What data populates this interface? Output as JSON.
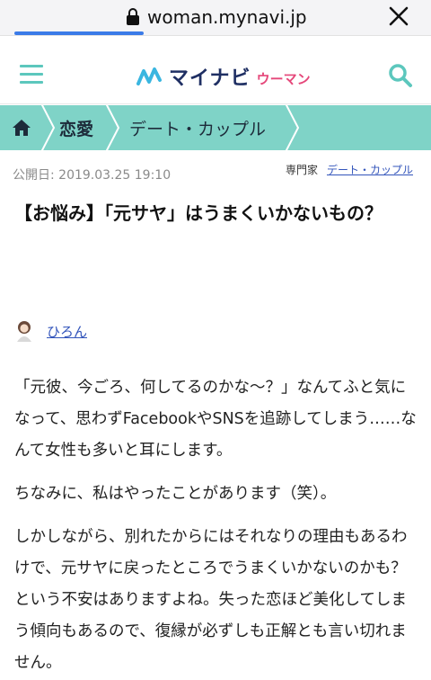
{
  "browser": {
    "url": "woman.mynavi.jp",
    "page_load_progress": 0.3
  },
  "header": {
    "logo_main": "マイナビ",
    "logo_sub": "ウーマン"
  },
  "breadcrumb": {
    "items": [
      "恋愛",
      "デート・カップル"
    ]
  },
  "article": {
    "published": "公開日: 2019.03.25 19:10",
    "expert_label": "専門家",
    "expert_category": "デート・カップル",
    "title": "【お悩み】「元サヤ」はうまくいかないもの？",
    "author": "ひろん",
    "paragraphs": [
      "「元彼、今ごろ、何してるのかな～？」なんてふと気になって、思わずFacebookやSNSを追跡してしまう……なんて女性も多いと耳にします。",
      "ちなみに、私はやったことがあります（笑）。",
      "しかしながら、別れたからにはそれなりの理由もあるわけで、元サヤに戻ったところでうまくいかないのかも？　という不安はありますよね。失った恋ほど美化してしまう傾向もあるので、復縁が必ずしも正解とも言い切れません。"
    ]
  },
  "colors": {
    "accent": "#7fd3c7",
    "icon_teal": "#5cc7bd",
    "link": "#3355bb",
    "progress": "#3b7be8"
  }
}
